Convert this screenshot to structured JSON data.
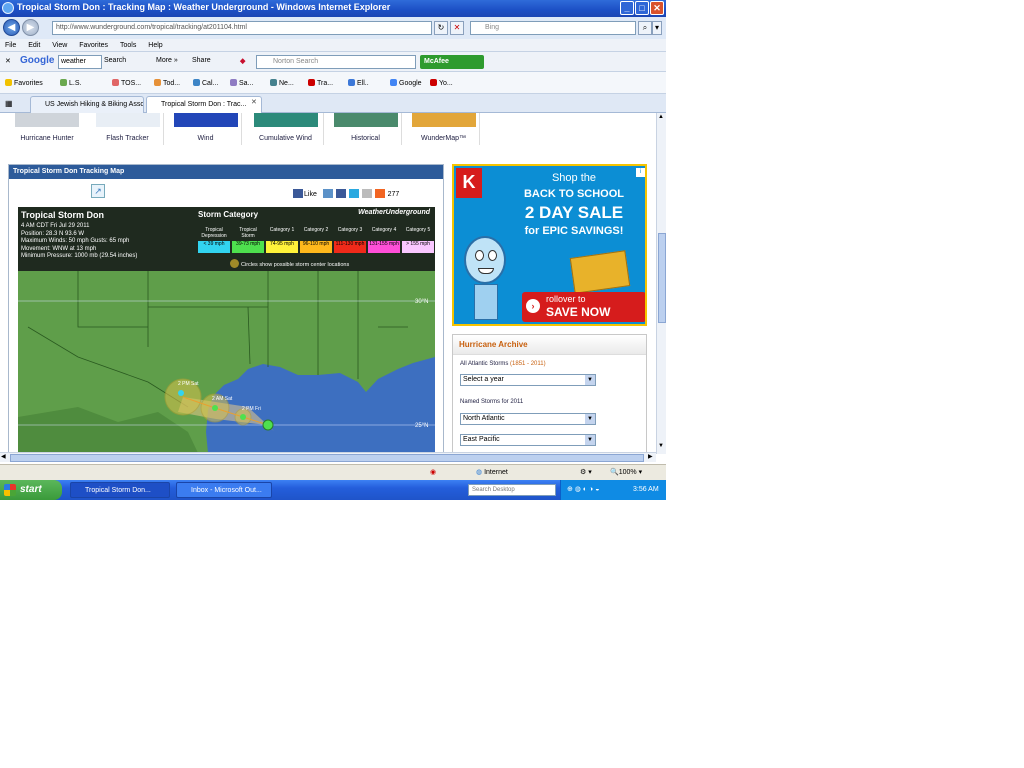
{
  "window": {
    "title": "Tropical Storm Don : Tracking Map : Weather Underground - Windows Internet Explorer",
    "minimize": "_",
    "maximize": "□",
    "close": "✕"
  },
  "address": {
    "url": "http://www.wunderground.com/tropical/tracking/at201104.html",
    "search_placeholder": "Bing"
  },
  "menu": [
    "File",
    "Edit",
    "View",
    "Favorites",
    "Tools",
    "Help"
  ],
  "google_toolbar": {
    "brand": "Google",
    "query": "weather",
    "search_label": "Search",
    "more_label": "More »",
    "share_label": "Share",
    "norton_placeholder": "Norton Search",
    "mcafee_label": "McAfee"
  },
  "favorites": {
    "label": "Favorites",
    "items": [
      "L.S.",
      "TOS...",
      "Tod...",
      "Cal...",
      "Sa...",
      "Ne...",
      "Tra...",
      "Ell..",
      "Google",
      "Yo..."
    ]
  },
  "tabs": [
    {
      "label": "US Jewish Hiking & Biking Associa...",
      "active": false
    },
    {
      "label": "Tropical Storm Don : Trac...",
      "active": true
    }
  ],
  "thumbnails": [
    "Hurricane Hunter",
    "Flash Tracker",
    "Wind",
    "Cumulative Wind",
    "Historical",
    "WunderMap™"
  ],
  "map": {
    "header": "Tropical Storm Don Tracking Map",
    "share_count": "277",
    "like_label": "Like",
    "storm_name": "Tropical Storm Don",
    "info_lines": [
      "4 AM CDT Fri Jul 29 2011",
      "Position: 28.3 N 93.6 W",
      "Maximum Winds: 50 mph   Gusts: 65 mph",
      "Movement: WNW at 13 mph",
      "Minimum Pressure: 1000 mb (29.54 inches)"
    ],
    "category_title": "Storm Category",
    "brand": "WeatherUnderground",
    "categories": [
      {
        "name": "Tropical Depression",
        "range": "< 39 mph",
        "color": "#32d4f0"
      },
      {
        "name": "Tropical Storm",
        "range": "39-73 mph",
        "color": "#4ee04e"
      },
      {
        "name": "Category 1",
        "range": "74-95 mph",
        "color": "#fff23a"
      },
      {
        "name": "Category 2",
        "range": "96-110 mph",
        "color": "#ffb81c"
      },
      {
        "name": "Category 3",
        "range": "111-130 mph",
        "color": "#f02a1a"
      },
      {
        "name": "Category 4",
        "range": "131-155 mph",
        "color": "#ff4fd8"
      },
      {
        "name": "Category 5",
        "range": "> 155 mph",
        "color": "#f9c7ff"
      }
    ],
    "note": "Circles show possible storm center locations",
    "lat_labels": [
      "30°N",
      "25°N"
    ],
    "points": [
      "2 PM Sat",
      "2 AM Sat",
      "2 PM Fri"
    ]
  },
  "ad": {
    "line1": "Shop the",
    "line2": "BACK TO SCHOOL",
    "line3": "2 DAY SALE",
    "line4": "for EPIC SAVINGS!",
    "cta1": "rollover to",
    "cta2": "SAVE NOW",
    "accent": "#d61c1c"
  },
  "archive": {
    "title": "Hurricane Archive",
    "all_storms_label": "All Atlantic Storms",
    "all_storms_range": "(1851 - 2011)",
    "year_select": "Select a year",
    "named_label": "Named Storms for 2011",
    "basin1": "North Atlantic",
    "basin2": "East Pacific"
  },
  "status": {
    "zone": "Internet",
    "zoom": "100%"
  },
  "taskbar": {
    "start": "start",
    "tasks": [
      "Tropical Storm Don...",
      "Inbox - Microsoft Out..."
    ],
    "desktop_search": "Search Desktop",
    "clock": "3:56 AM"
  }
}
